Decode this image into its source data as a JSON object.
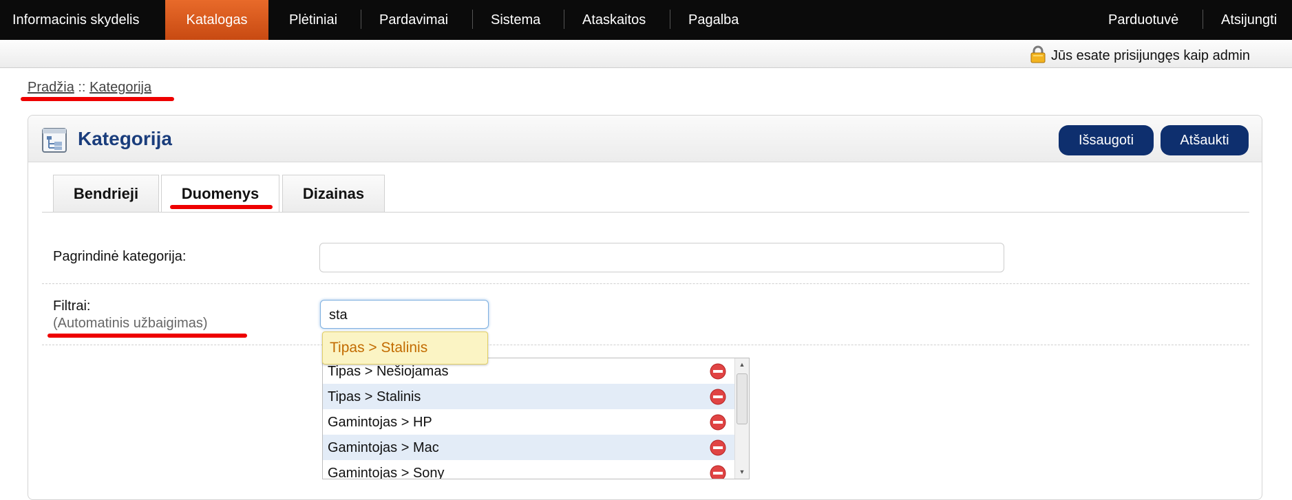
{
  "nav": {
    "items": [
      "Informacinis skydelis",
      "Katalogas",
      "Plėtiniai",
      "Pardavimai",
      "Sistema",
      "Ataskaitos",
      "Pagalba"
    ],
    "active": "Katalogas",
    "right": [
      "Parduotuvė",
      "Atsijungti"
    ]
  },
  "userbar": {
    "text": "Jūs esate prisijungęs kaip admin"
  },
  "breadcrumb": {
    "home": "Pradžia",
    "sep": "::",
    "current": "Kategorija"
  },
  "panel": {
    "title": "Kategorija",
    "save": "Išsaugoti",
    "cancel": "Atšaukti"
  },
  "tabs": [
    "Bendrieji",
    "Duomenys",
    "Dizainas"
  ],
  "active_tab": "Duomenys",
  "form": {
    "parent_label": "Pagrindinė kategorija:",
    "parent_value": "",
    "filters_label": "Filtrai:",
    "filters_help": "(Automatinis užbaigimas)",
    "filters_value": "sta",
    "autocomplete": "Tipas > Stalinis",
    "selected_filters": [
      "Tipas > Nešiojamas",
      "Tipas > Stalinis",
      "Gamintojas > HP",
      "Gamintojas > Mac",
      "Gamintojas > Sony"
    ]
  },
  "colors": {
    "nav_bg": "#0b0b0b",
    "nav_active": "#d9561a",
    "title": "#1a3d7c",
    "button": "#0e2f6e",
    "highlight_row": "#e3ecf7",
    "annotation": "#e00000"
  },
  "icons": {
    "lock": "lock-icon",
    "panel": "category-tree-icon",
    "remove": "remove-circle-icon"
  }
}
